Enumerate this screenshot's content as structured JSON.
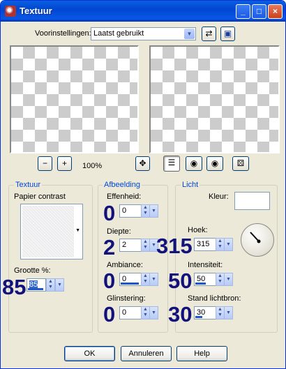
{
  "window": {
    "title": "Textuur",
    "minimize": "_",
    "maximize": "□",
    "close": "×"
  },
  "presets": {
    "label": "Voorinstellingen:",
    "value": "Laatst gebruikt"
  },
  "toolbar": {
    "zoom_out": "−",
    "zoom_in": "+",
    "zoom_level": "100%",
    "move": "✥",
    "randomize": "⚄"
  },
  "texture": {
    "group_title": "Textuur",
    "name": "Papier contrast",
    "size_label": "Grootte %:",
    "size_value": "85",
    "size_big": "85"
  },
  "image": {
    "group_title": "Afbeelding",
    "smoothness": {
      "label": "Effenheid:",
      "value": "0",
      "big": "0"
    },
    "depth": {
      "label": "Diepte:",
      "value": "2",
      "big": "2"
    },
    "ambience": {
      "label": "Ambiance:",
      "value": "0",
      "big": "0"
    },
    "gloss": {
      "label": "Glinstering:",
      "value": "0",
      "big": "0"
    }
  },
  "light": {
    "group_title": "Licht",
    "color_label": "Kleur:",
    "color_value": "#ffffff",
    "angle": {
      "label": "Hoek:",
      "value": "315",
      "big": "315"
    },
    "intensity": {
      "label": "Intensiteit:",
      "value": "50",
      "big": "50"
    },
    "elevation": {
      "label": "Stand lichtbron:",
      "value": "30",
      "big": "30"
    }
  },
  "buttons": {
    "ok": "OK",
    "cancel": "Annuleren",
    "help": "Help"
  }
}
